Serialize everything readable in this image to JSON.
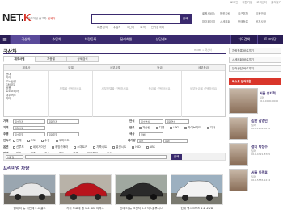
{
  "header": {
    "top_links": [
      "로그인",
      "회원가입",
      "고객센터",
      "즐겨찾기"
    ],
    "logo_main": "NET.",
    "logo_accent": "K",
    "tagline_prefix": "프리미엄 중고차 ",
    "tagline_accent": "넷케이",
    "search_button": "검색",
    "quick_links": [
      "빠른검색",
      "수입차",
      "국산차",
      "트럭",
      "인기검색어"
    ],
    "right_links": [
      "회원서비스",
      "찜한차량",
      "최근본차",
      "이용안내",
      "마이페이지",
      "시세조회",
      "판매등록",
      "공지사항"
    ]
  },
  "nav": {
    "items": [
      "국산차",
      "수입차",
      "차량등록",
      "딜러회원",
      "상담센터"
    ],
    "active_index": 0,
    "right": [
      "지도검색",
      "토크마당"
    ]
  },
  "page": {
    "title": "국산차",
    "breadcrumb": "HOME > 국산차"
  },
  "tabs": [
    "제조사별",
    "차종별",
    "상세검색"
  ],
  "grid": {
    "columns": [
      "제조사",
      "모델",
      "세부모델",
      "등급",
      "세부등급"
    ],
    "makers": [
      "현대",
      "기아",
      "르노삼성",
      "GM대우",
      "쌍용",
      "르노코리아",
      "대우버스",
      "기타"
    ],
    "hints": [
      "모델을 선택하세요",
      "세부모델을 선택하세요",
      "등급을 선택하세요",
      "세부등급을 선택하세요"
    ]
  },
  "filters": [
    {
      "label": "가격",
      "selects": [
        "최소가격",
        "최대가격"
      ],
      "label2": "연식",
      "selects2": [
        "최소연식",
        "최대연식"
      ]
    },
    {
      "label": "지역",
      "selects": [
        "지역선택"
      ],
      "label2": "연료",
      "options2": [
        "가솔린",
        "디젤",
        "LPG",
        "하이브리드",
        "기타"
      ]
    },
    {
      "label": "주행",
      "selects": [
        "최소주행",
        "최대주행"
      ],
      "label2": "색상",
      "selects2": [
        "전체"
      ]
    },
    {
      "label": "변속기",
      "options": [
        "전체",
        "오토",
        "수동",
        "세미오토"
      ],
      "label2": "배기량",
      "selects2": [
        "최소",
        "최대"
      ]
    },
    {
      "label": "옵션",
      "options": [
        "선루프",
        "네비게이션",
        "후방카메라",
        "스마트키",
        "가죽시트",
        "열선시트",
        "HID",
        "ABS"
      ]
    },
    {
      "label": "판매",
      "options": [
        "일반",
        "인증",
        "리스",
        "렌트",
        "보증",
        "전문판매",
        "SMS"
      ]
    }
  ],
  "bottom_search": {
    "select": "차량명",
    "button": "검색"
  },
  "premium": {
    "title": "프리미엄 차량",
    "cars": [
      {
        "caption": "현대 더 뉴 아반떼 2.0 골드",
        "color": "#e8e8e8"
      },
      {
        "caption": "기아 포르테 쿱 1.6 GDi 디럭스",
        "color": "#b8131c"
      },
      {
        "caption": "현대 더 뉴 그랜저 3.0 익스클루시브",
        "color": "#2a2a2a"
      },
      {
        "caption": "현대 맥스크루즈 2.2 4WD",
        "color": "#f2f2f2"
      }
    ]
  },
  "sidebar": {
    "buttons": [
      "차량등록 바로가기",
      "시세조회 바로가기",
      "딜러상담 바로가기"
    ],
    "head": "베스트 딜러회원",
    "profiles": [
      {
        "name": "서울 유지혁",
        "role": "딜러",
        "phone": "010-0000-0000"
      },
      {
        "name": "김한 김영민",
        "role": "딜러",
        "phone": "010-1234-5678"
      },
      {
        "name": "경기 박정수",
        "role": "딜러",
        "phone": "010-4321-8765"
      },
      {
        "name": "서울 이준호",
        "role": "딜러",
        "phone": "010-5555-1234"
      }
    ]
  }
}
